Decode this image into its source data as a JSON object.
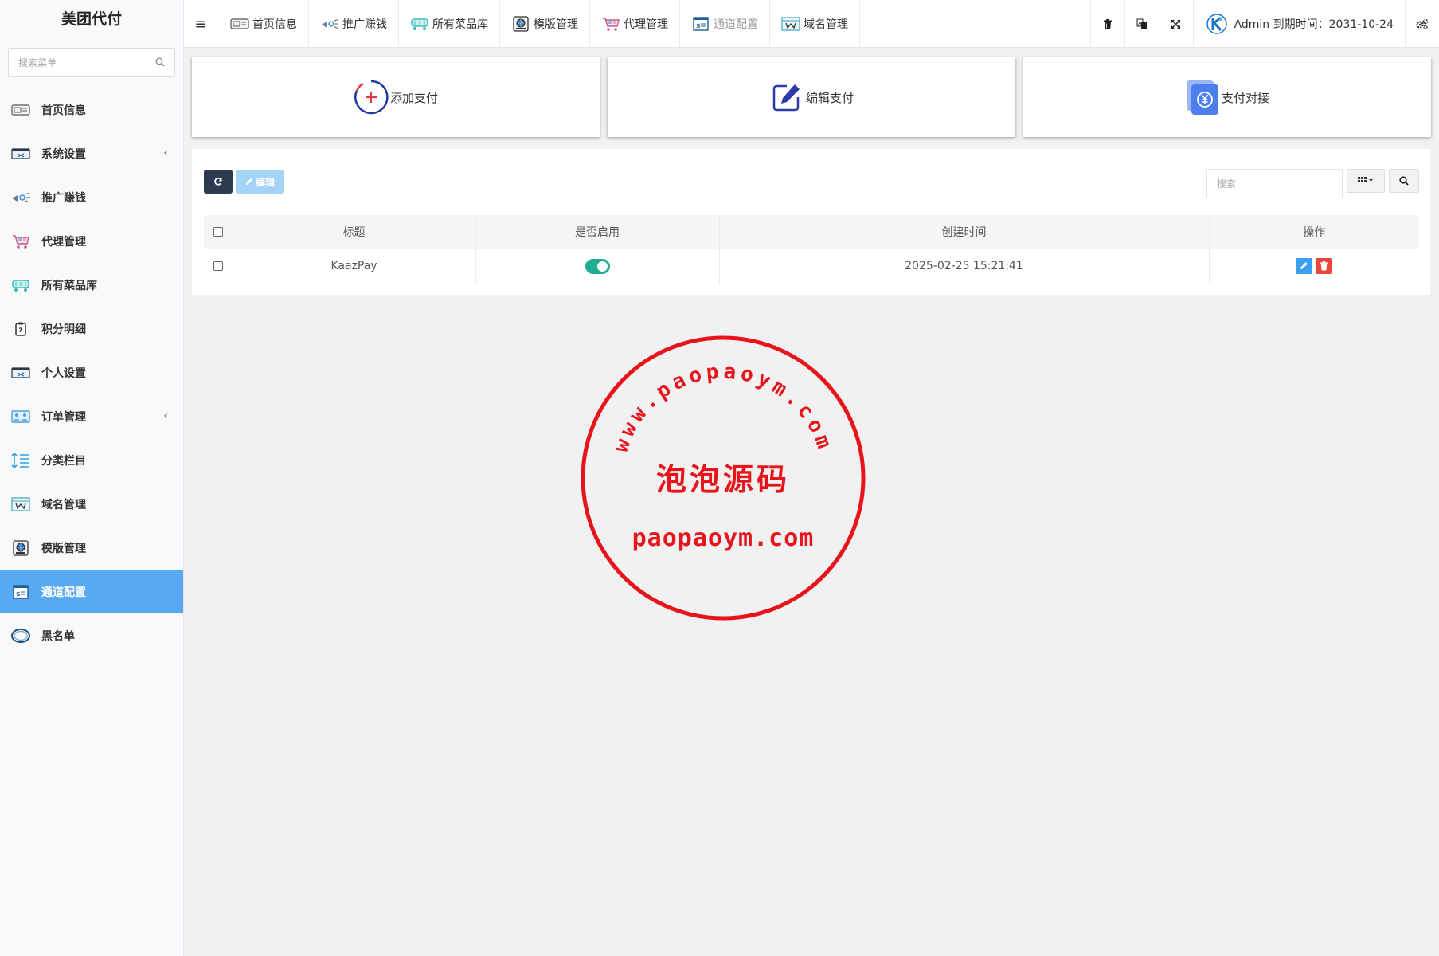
{
  "sidebar": {
    "brand": "美团代付",
    "search_placeholder": "搜索菜单",
    "items": [
      {
        "label": "首页信息",
        "icon": "dashboard-icon",
        "chevron": ""
      },
      {
        "label": "系统设置",
        "icon": "system-settings-icon",
        "chevron": "‹"
      },
      {
        "label": "推广赚钱",
        "icon": "promotion-icon",
        "chevron": ""
      },
      {
        "label": "代理管理",
        "icon": "agent-cart-icon",
        "chevron": ""
      },
      {
        "label": "所有菜品库",
        "icon": "dishes-icon",
        "chevron": ""
      },
      {
        "label": "积分明细",
        "icon": "points-icon",
        "chevron": ""
      },
      {
        "label": "个人设置",
        "icon": "personal-settings-icon",
        "chevron": ""
      },
      {
        "label": "订单管理",
        "icon": "orders-icon",
        "chevron": "‹"
      },
      {
        "label": "分类栏目",
        "icon": "category-icon",
        "chevron": ""
      },
      {
        "label": "域名管理",
        "icon": "domain-icon",
        "chevron": ""
      },
      {
        "label": "模版管理",
        "icon": "template-icon",
        "chevron": ""
      },
      {
        "label": "通道配置",
        "icon": "channel-config-icon",
        "chevron": "",
        "active": true
      },
      {
        "label": "黑名单",
        "icon": "blacklist-icon",
        "chevron": ""
      }
    ]
  },
  "topbar": {
    "tabs": [
      {
        "label": "首页信息",
        "icon": "dashboard-icon"
      },
      {
        "label": "推广赚钱",
        "icon": "promotion-icon"
      },
      {
        "label": "所有菜品库",
        "icon": "dishes-icon"
      },
      {
        "label": "模版管理",
        "icon": "template-icon"
      },
      {
        "label": "代理管理",
        "icon": "agent-cart-icon"
      },
      {
        "label": "通道配置",
        "icon": "channel-config-icon",
        "current": true
      },
      {
        "label": "域名管理",
        "icon": "domain-icon"
      }
    ],
    "user_text": "Admin 到期时间：2031-10-24"
  },
  "cards": {
    "add": "添加支付",
    "edit": "编辑支付",
    "connect": "支付对接"
  },
  "toolbar": {
    "edit_label": "编辑",
    "search_placeholder": "搜索"
  },
  "table": {
    "headers": [
      "标题",
      "是否启用",
      "创建时间",
      "操作"
    ],
    "rows": [
      {
        "title": "KaazPay",
        "enabled": true,
        "created": "2025-02-25 15:21:41"
      }
    ]
  },
  "watermark": {
    "arc_text": "www.paopaoym.com",
    "center_text": "泡泡源码",
    "bottom_text": "paopaoym.com",
    "color": "#e8141b"
  },
  "colors": {
    "active_menu": "#57a9f2",
    "refresh_button": "#2c3b4f",
    "edit_button": "#a3d3f7",
    "toggle_on": "#1fae8f",
    "op_edit": "#3c9ef0",
    "op_delete": "#e8463f"
  }
}
